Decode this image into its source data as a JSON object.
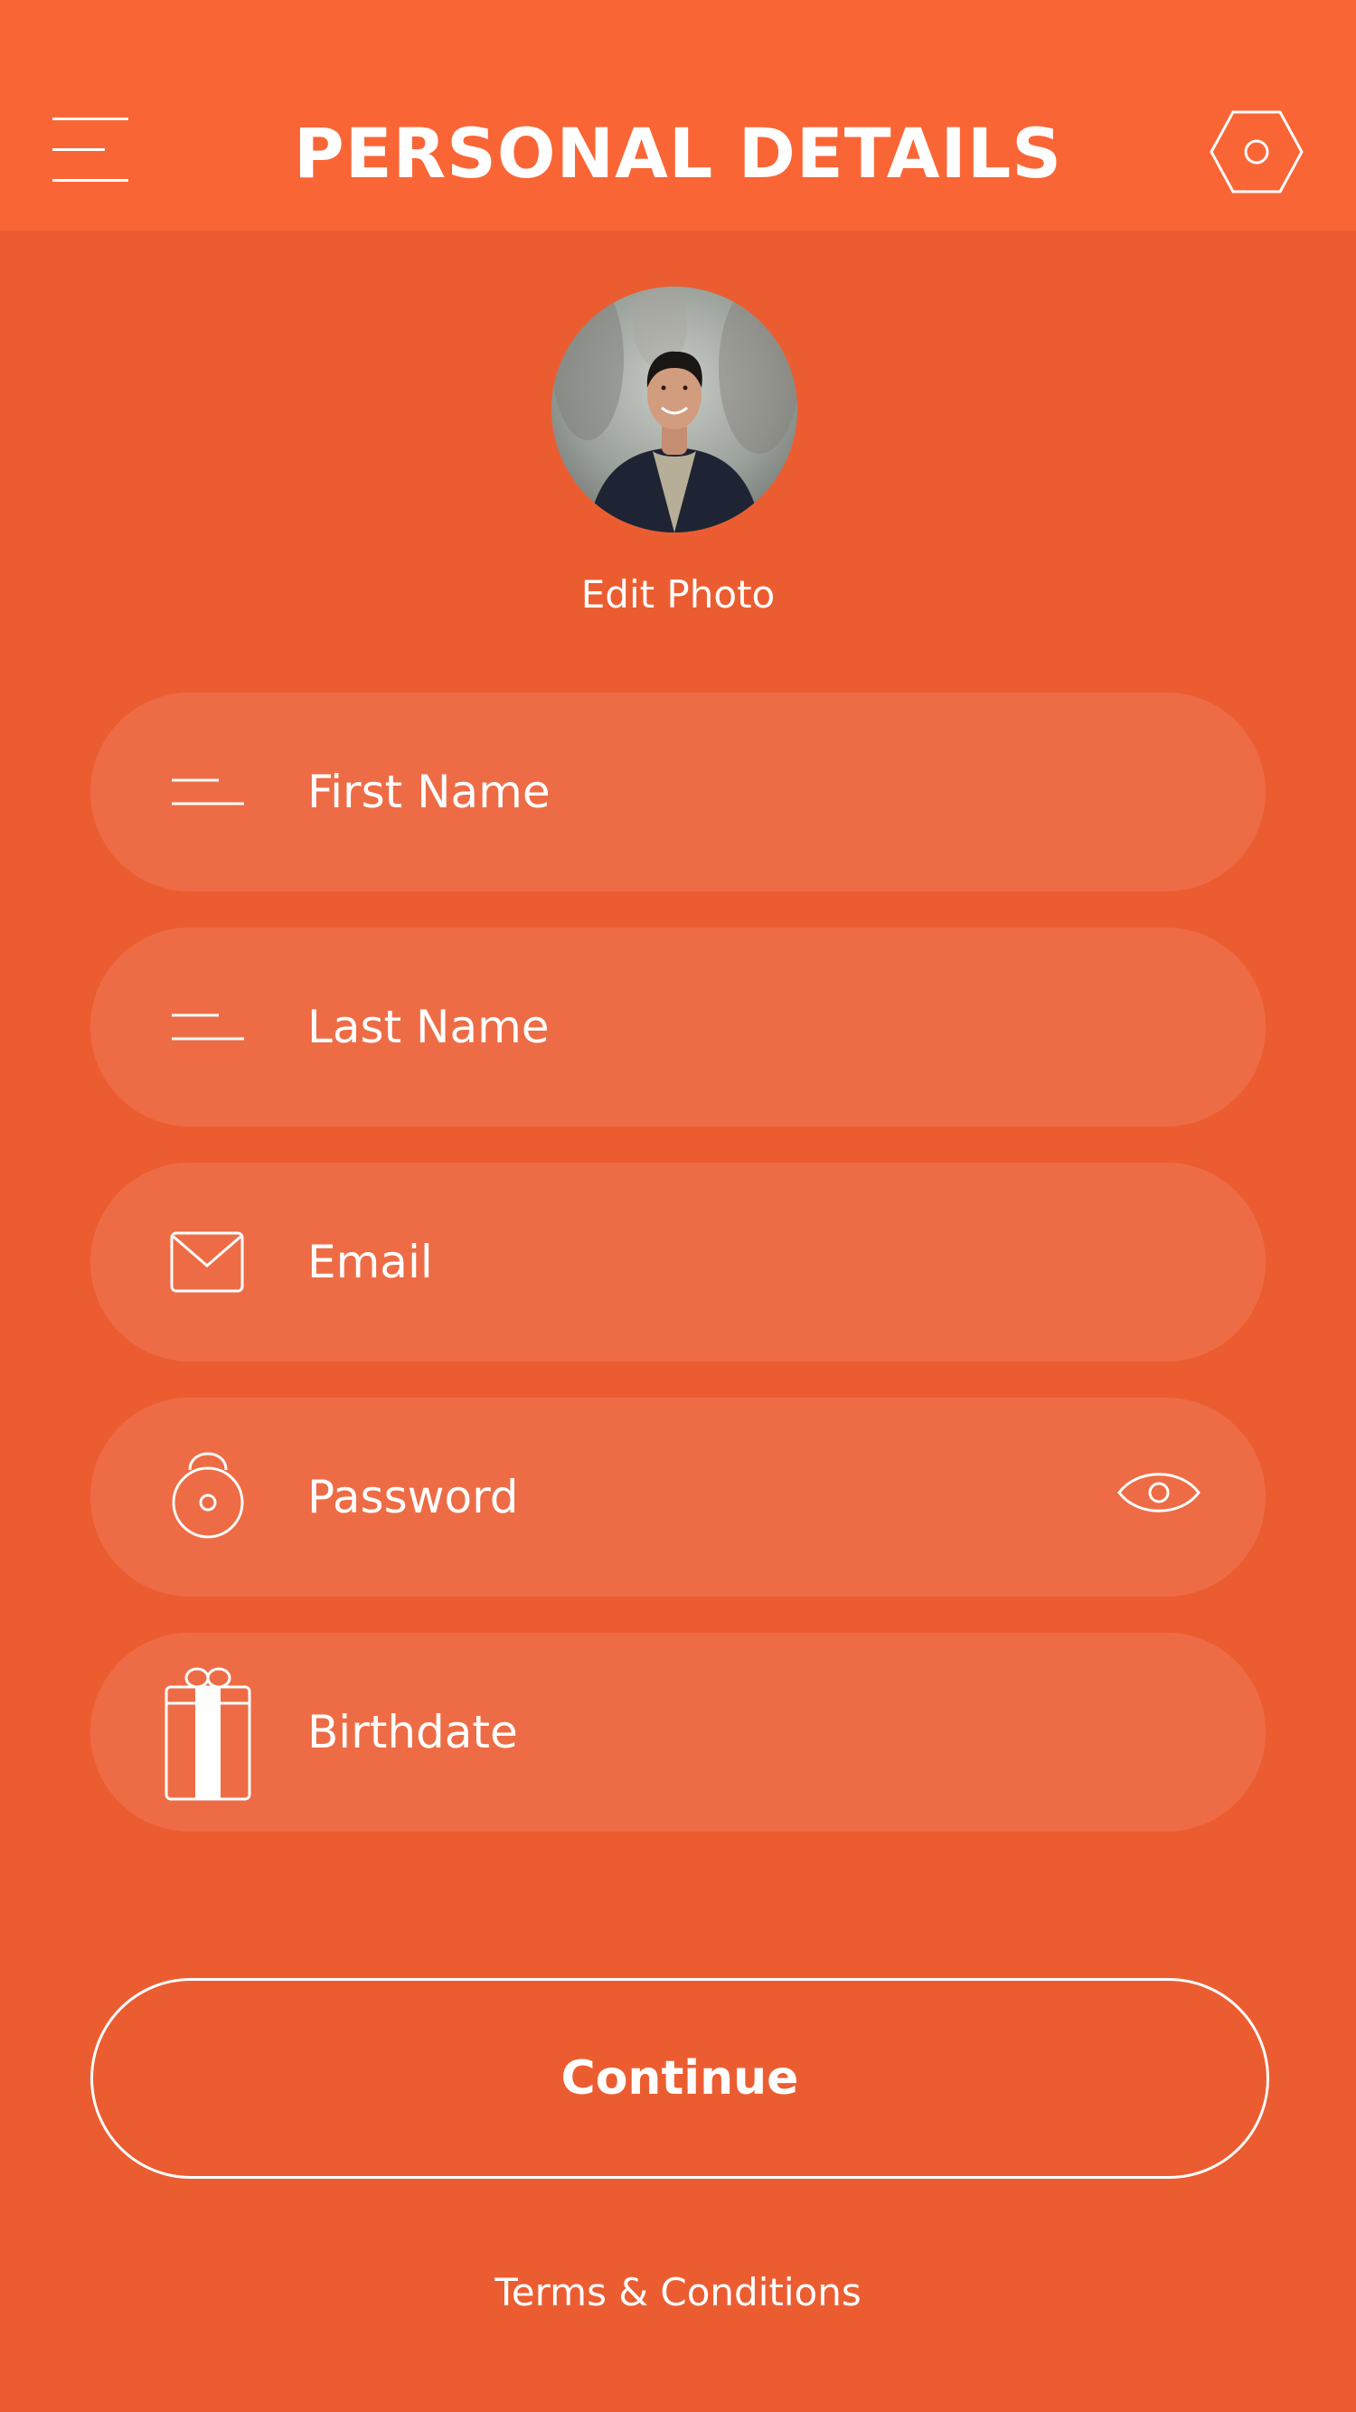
{
  "header": {
    "title": "PERSONAL DETAILS",
    "background": "#FA6535",
    "menu_icon": "hamburger-menu-icon",
    "settings_icon": "hexagon-settings-icon"
  },
  "profile": {
    "edit_photo_label": "Edit Photo"
  },
  "form": {
    "fields": [
      {
        "label": "First Name",
        "icon": "text-lines-icon"
      },
      {
        "label": "Last Name",
        "icon": "text-lines-icon"
      },
      {
        "label": "Email",
        "icon": "envelope-icon"
      },
      {
        "label": "Password",
        "icon": "lock-icon",
        "toggle_icon": "eye-icon"
      },
      {
        "label": "Birthdate",
        "icon": "gift-icon"
      }
    ]
  },
  "actions": {
    "continue_label": "Continue",
    "terms_label": "Terms & Conditions"
  },
  "colors": {
    "background": "#EB5D31",
    "field_background": "#EE6C45",
    "text": "#FFFFFF"
  }
}
